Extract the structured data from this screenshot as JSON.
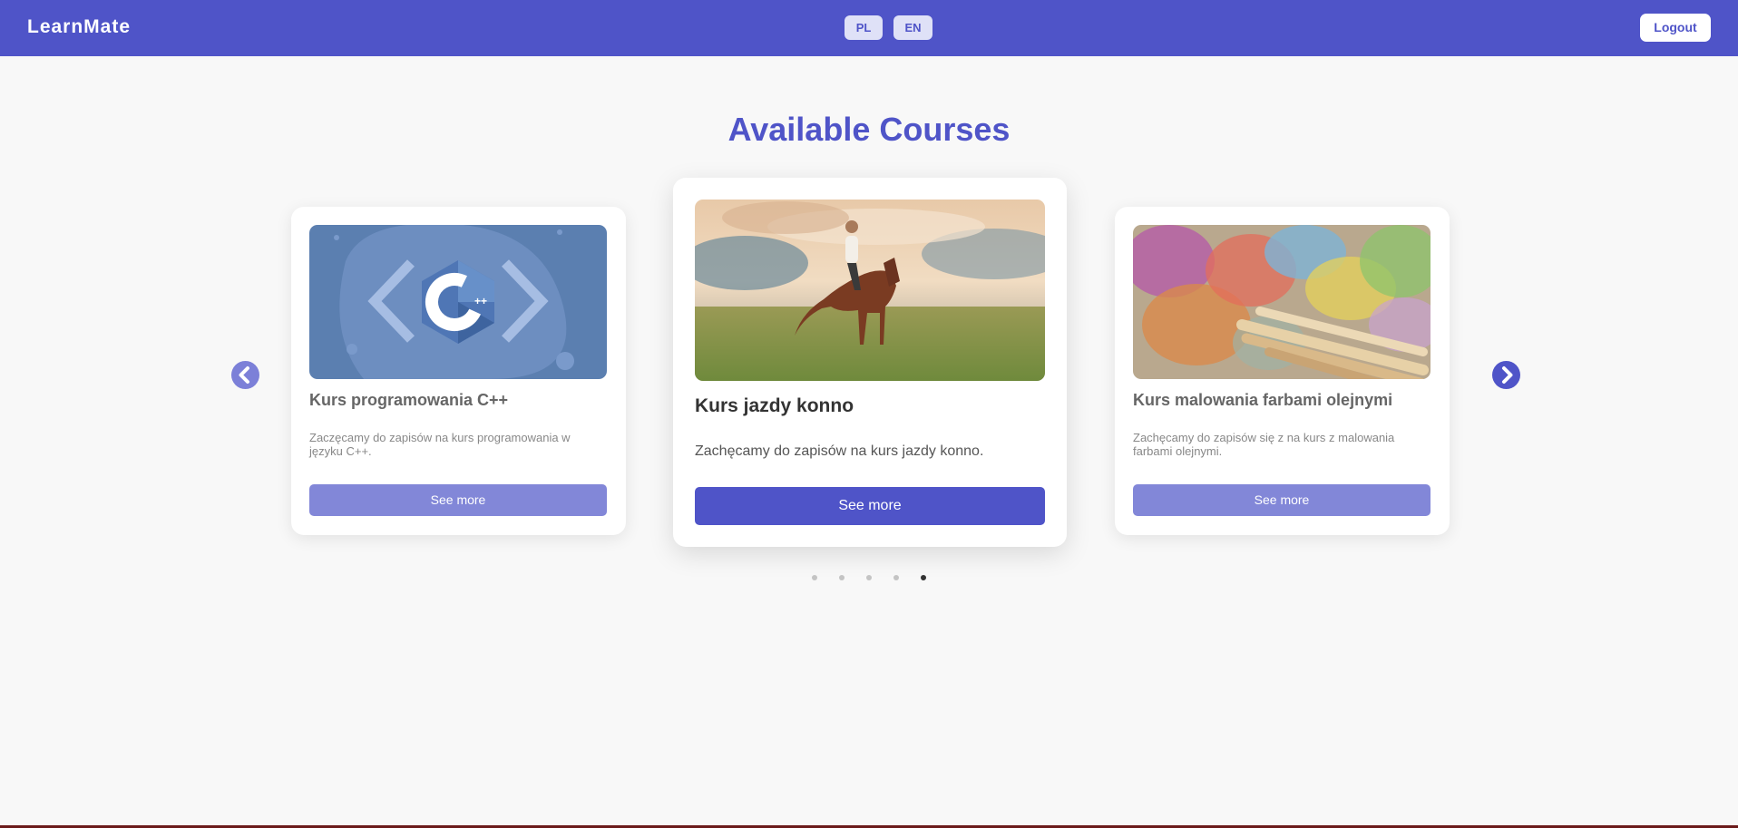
{
  "header": {
    "brand": "LearnMate",
    "languages": [
      "PL",
      "EN"
    ],
    "logout_label": "Logout",
    "accent_color": "#4f54c8"
  },
  "main": {
    "title": "Available Courses",
    "carousel": {
      "cards": [
        {
          "title": "Kurs programowania C++",
          "description": "Zaczęcamy do zapisów na kurs programowania w języku C++.",
          "button_label": "See more",
          "image": "cpp-logo-illustration"
        },
        {
          "title": "Kurs jazdy konno",
          "description": "Zachęcamy do zapisów na kurs jazdy konno.",
          "button_label": "See more",
          "image": "horse-rider-photo"
        },
        {
          "title": "Kurs malowania farbami olejnymi",
          "description": "Zachęcamy do zapisów się z na kurs z malowania farbami olejnymi.",
          "button_label": "See more",
          "image": "oil-paint-brushes-photo"
        }
      ],
      "prev_icon": "chevron-left-circle-icon",
      "next_icon": "chevron-right-circle-icon",
      "dots_count": 5,
      "active_dot": 5
    }
  }
}
